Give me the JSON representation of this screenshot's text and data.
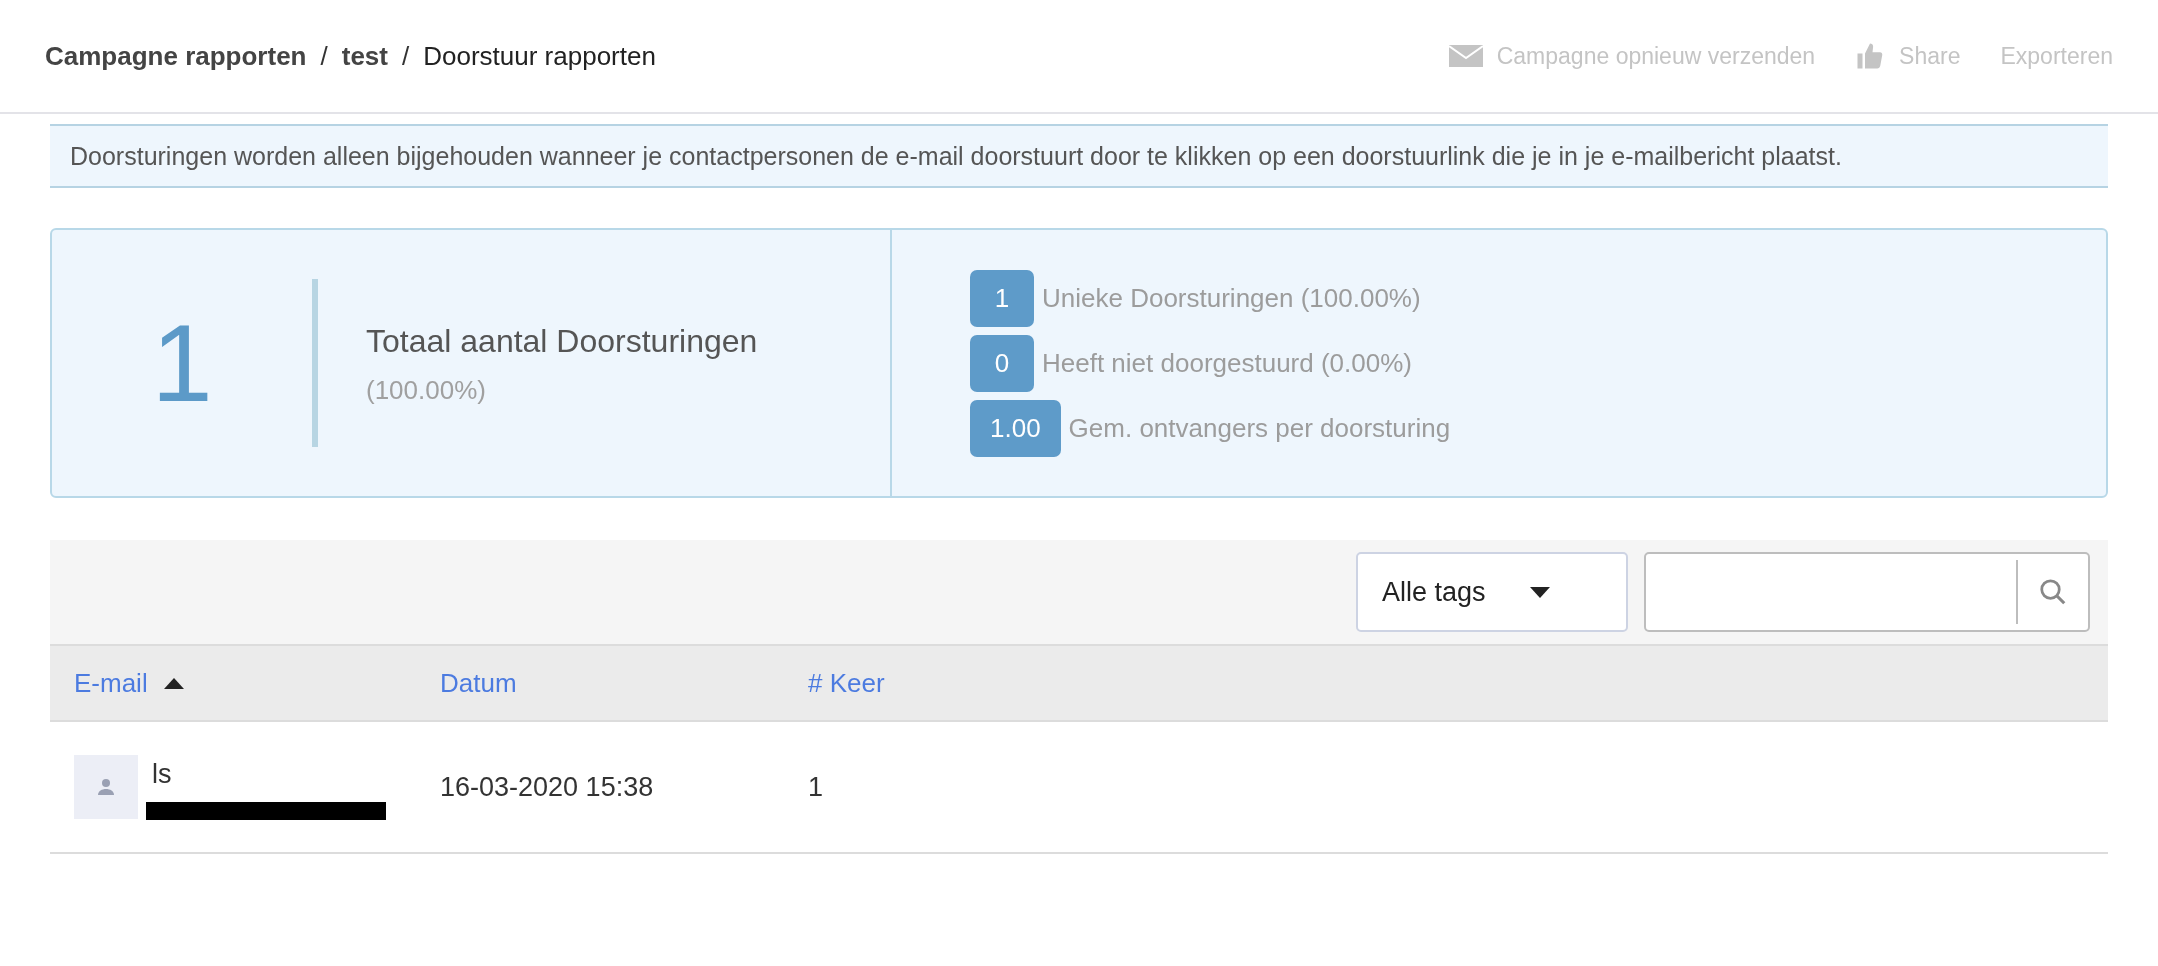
{
  "breadcrumb": [
    {
      "label": "Campagne rapporten",
      "current": false
    },
    {
      "label": "test",
      "current": false
    },
    {
      "label": "Doorstuur rapporten",
      "current": true
    }
  ],
  "breadcrumb_separator": "/",
  "actions": [
    {
      "kind": "mail",
      "label": "Campagne opnieuw verzenden"
    },
    {
      "kind": "like",
      "label": "Share"
    },
    {
      "kind": "plain",
      "label": "Exporteren"
    }
  ],
  "notice": "Doorsturingen worden alleen bijgehouden wanneer je contactpersonen de e-mail doorstuurt door te klikken op een doorstuurlink die je in je e-mailbericht plaatst.",
  "summary": {
    "total": "1",
    "title": "Totaal aantal Doorsturingen",
    "percent": "(100.00%)"
  },
  "stats": [
    {
      "value": "1",
      "label": "Unieke Doorsturingen (100.00%)"
    },
    {
      "value": "0",
      "label": "Heeft niet doorgestuurd (0.00%)"
    },
    {
      "value": "1.00",
      "label": "Gem. ontvangers per doorsturing"
    }
  ],
  "filters": {
    "tag_select": "Alle tags"
  },
  "table": {
    "columns": [
      {
        "label": "E-mail",
        "sorted": true
      },
      {
        "label": "Datum",
        "sorted": false
      },
      {
        "label": "# Keer",
        "sorted": false
      }
    ],
    "rows": [
      {
        "name": "ls",
        "email_redacted": true,
        "date": "16-03-2020 15:38",
        "count": "1"
      }
    ]
  }
}
